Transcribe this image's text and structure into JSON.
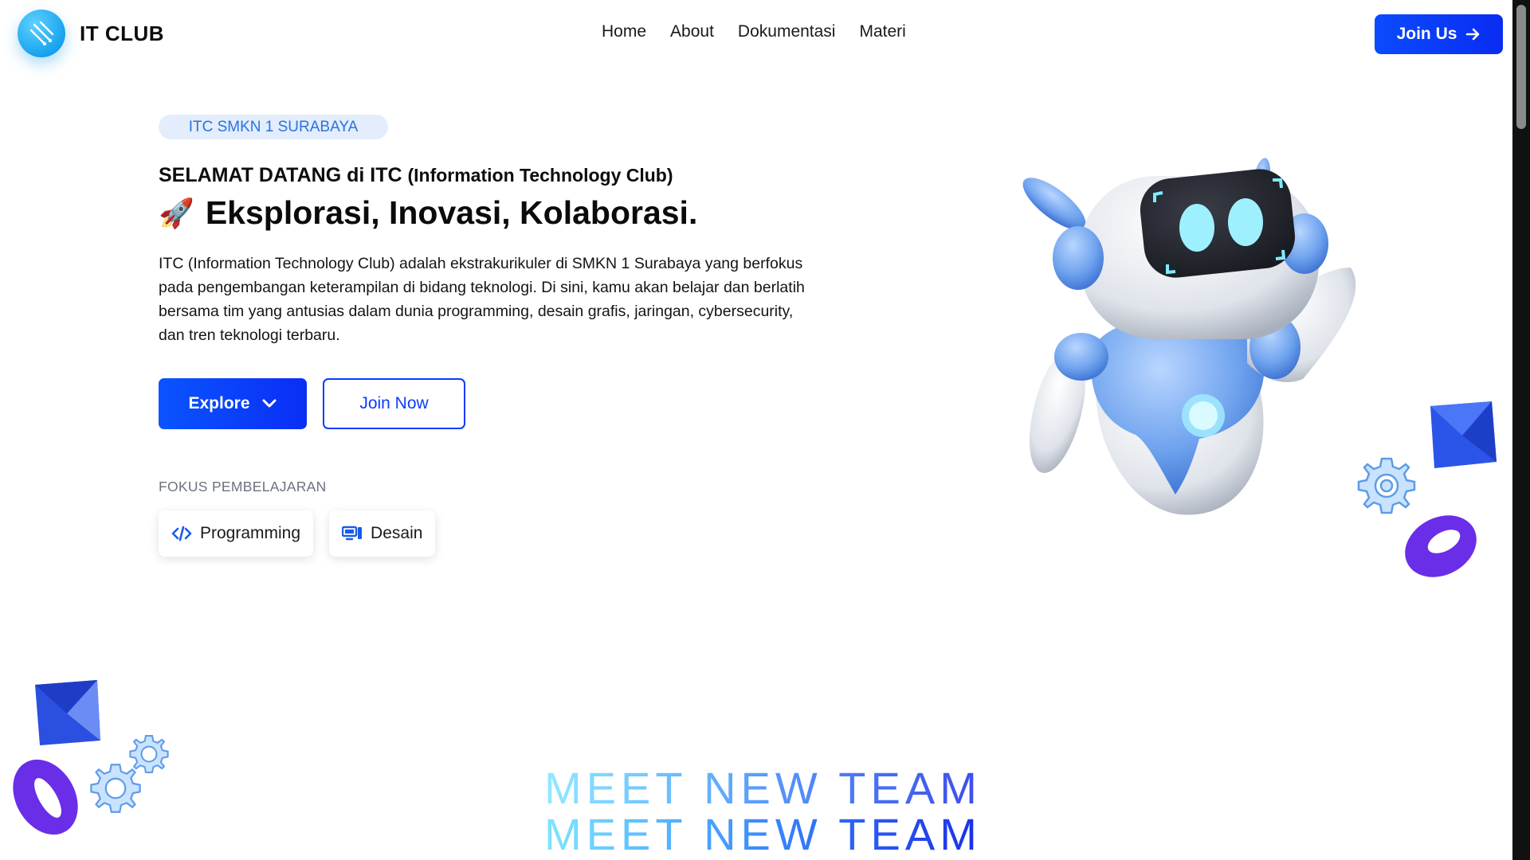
{
  "header": {
    "logo_text": "IT CLUB",
    "nav": [
      {
        "label": "Home"
      },
      {
        "label": "About"
      },
      {
        "label": "Dokumentasi"
      },
      {
        "label": "Materi"
      }
    ],
    "cta_label": "Join Us"
  },
  "hero": {
    "badge": "ITC SMKN 1 SURABAYA",
    "welcome_main": "SELAMAT DATANG di ITC ",
    "welcome_paren": "(Information Technology Club)",
    "tagline": "Eksplorasi, Inovasi, Kolaborasi.",
    "rocket": "🚀",
    "description": "ITC (Information Technology Club) adalah ekstrakurikuler di SMKN 1 Surabaya yang berfokus pada pengembangan keterampilan di bidang teknologi. Di sini, kamu akan belajar dan berlatih bersama tim yang antusias dalam dunia programming, desain grafis, jaringan, cybersecurity, dan tren teknologi terbaru.",
    "explore_label": "Explore",
    "join_now_label": "Join Now",
    "focus_label": "FOKUS PEMBELAJARAN",
    "focus": [
      {
        "label": "Programming",
        "icon": "code-icon"
      },
      {
        "label": "Desain",
        "icon": "monitor-icon"
      }
    ]
  },
  "team_section": {
    "heading": "MEET NEW TEAM"
  },
  "colors": {
    "primary": "#0a3cff",
    "badge_bg": "#e3edfb",
    "badge_text": "#2a73e0",
    "logo": "#17a3ef"
  }
}
